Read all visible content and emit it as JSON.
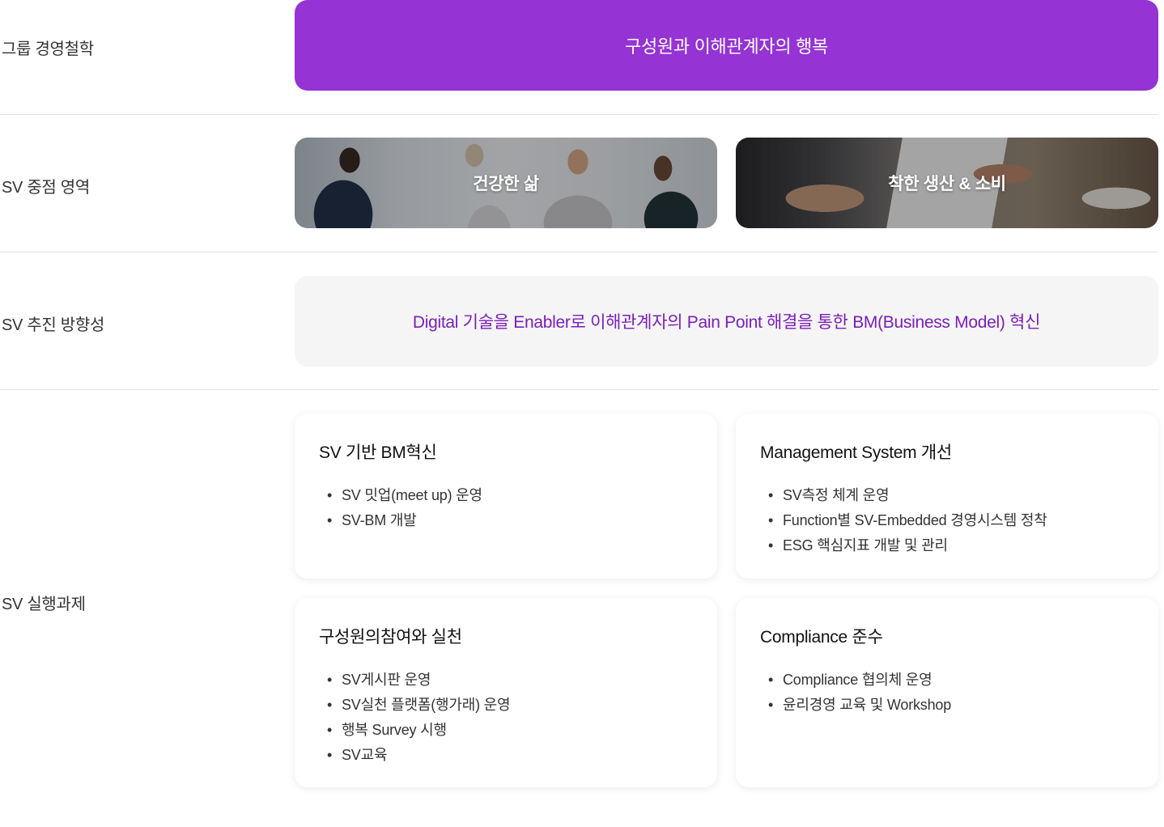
{
  "rows": {
    "philosophy": {
      "label": "그룹 경영철학",
      "value": "구성원과 이해관계자의 행복"
    },
    "focus": {
      "label": "SV 중점 영역",
      "cards": [
        {
          "label": "건강한 삶"
        },
        {
          "label": "착한 생산 & 소비"
        }
      ]
    },
    "direction": {
      "label": "SV 추진 방향성",
      "value": "Digital 기술을 Enabler로 이해관계자의 Pain Point 해결을 통한 BM(Business Model) 혁신"
    },
    "tasks": {
      "label": "SV 실행과제",
      "cards": [
        {
          "title": "SV 기반 BM혁신",
          "items": [
            "SV 밋업(meet up) 운영",
            "SV-BM 개발"
          ]
        },
        {
          "title": "Management System 개선",
          "items": [
            "SV측정 체계 운영",
            "Function별 SV-Embedded 경영시스템 정착",
            "ESG 핵심지표 개발 및 관리"
          ]
        },
        {
          "title": "구성원의참여와 실천",
          "items": [
            "SV게시판 운영",
            "SV실천 플랫폼(행가래) 운영",
            "행복 Survey 시행",
            "SV교육"
          ]
        },
        {
          "title": "Compliance 준수",
          "items": [
            "Compliance 협의체 운영",
            "윤리경영 교육 및 Workshop"
          ]
        }
      ]
    }
  },
  "colors": {
    "accent": "#9533d4",
    "direction_text": "#7b1fb8",
    "panel_bg": "#f5f5f5",
    "divider": "#e3e3e3"
  }
}
